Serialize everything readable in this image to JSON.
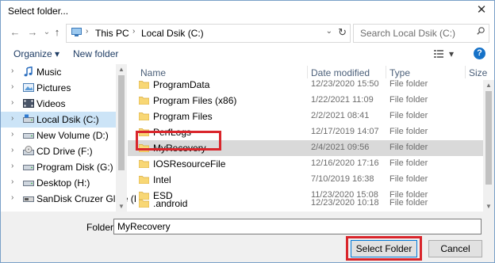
{
  "window": {
    "title": "Select folder...",
    "close_glyph": "✕"
  },
  "nav": {
    "back_glyph": "←",
    "forward_glyph": "→",
    "recent_glyph": "⌄",
    "up_glyph": "↑",
    "breadcrumb": [
      "This PC",
      "Local Dsik (C:)"
    ],
    "search_placeholder": "Search Local Dsik (C:)"
  },
  "toolbar": {
    "organize_label": "Organize ▾",
    "new_folder_label": "New folder",
    "view_caret": "▾",
    "help_glyph": "?"
  },
  "sidebar": {
    "items": [
      {
        "label": "Music",
        "icon": "music-icon"
      },
      {
        "label": "Pictures",
        "icon": "pictures-icon"
      },
      {
        "label": "Videos",
        "icon": "videos-icon"
      },
      {
        "label": "Local Dsik (C:)",
        "icon": "drive-icon",
        "selected": true
      },
      {
        "label": "New Volume (D:)",
        "icon": "drive-icon"
      },
      {
        "label": "CD Drive (F:)",
        "icon": "cd-icon"
      },
      {
        "label": "Program Disk  (G:)",
        "icon": "drive-icon"
      },
      {
        "label": "Desktop (H:)",
        "icon": "drive-icon"
      },
      {
        "label": "SanDisk Cruzer Glide (I",
        "icon": "usb-icon"
      }
    ]
  },
  "columns": {
    "name": "Name",
    "date": "Date modified",
    "type": "Type",
    "size": "Size"
  },
  "files": [
    {
      "name": "ProgramData",
      "date": "12/23/2020 15:50",
      "type": "File folder"
    },
    {
      "name": "Program Files (x86)",
      "date": "1/22/2021 11:09",
      "type": "File folder"
    },
    {
      "name": "Program Files",
      "date": "2/2/2021 08:41",
      "type": "File folder"
    },
    {
      "name": "PerfLogs",
      "date": "12/17/2019 14:07",
      "type": "File folder"
    },
    {
      "name": "MyRecovery",
      "date": "2/4/2021 09:56",
      "type": "File folder",
      "selected": true
    },
    {
      "name": "IOSResourceFile",
      "date": "12/16/2020 17:16",
      "type": "File folder"
    },
    {
      "name": "Intel",
      "date": "7/10/2019 16:38",
      "type": "File folder"
    },
    {
      "name": "ESD",
      "date": "11/23/2020 15:08",
      "type": "File folder"
    },
    {
      "name": ".android",
      "date": "12/23/2020 10:18",
      "type": "File folder"
    }
  ],
  "footer": {
    "folder_label": "Folder:",
    "folder_value": "MyRecovery",
    "select_button": "Select Folder",
    "cancel_button": "Cancel"
  },
  "colors": {
    "highlight": "#d9252b",
    "selection": "#cce4f7",
    "folder": "#f8d775",
    "accent": "#0078d7"
  }
}
